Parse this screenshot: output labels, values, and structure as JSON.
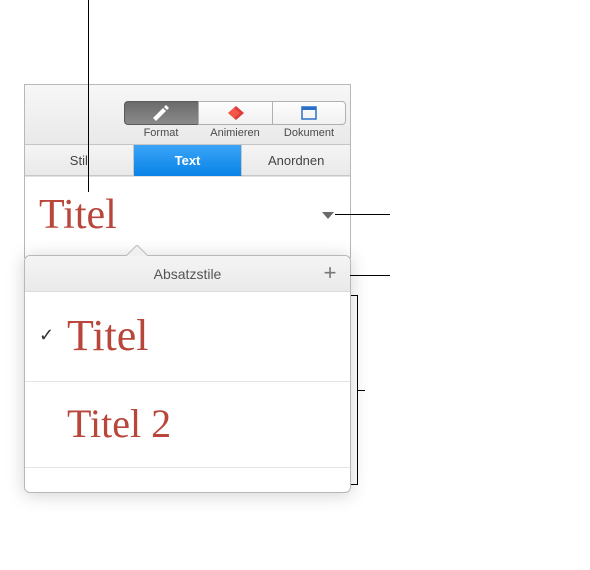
{
  "colors": {
    "accent_text": "#b8463b",
    "selected_tab_top": "#3aa4f8",
    "selected_tab_bottom": "#0a84e6"
  },
  "toolbar": {
    "items": [
      {
        "label": "Format",
        "icon": "brush-icon",
        "active": true
      },
      {
        "label": "Animieren",
        "icon": "diamond-icon",
        "active": false
      },
      {
        "label": "Dokument",
        "icon": "page-icon",
        "active": false
      }
    ]
  },
  "tabs": [
    {
      "label": "Stil",
      "selected": false
    },
    {
      "label": "Text",
      "selected": true
    },
    {
      "label": "Anordnen",
      "selected": false
    }
  ],
  "current_style": "Titel",
  "popover": {
    "title": "Absatzstile",
    "add_icon": "plus-icon",
    "items": [
      {
        "preview": "Titel",
        "selected": true,
        "size_class": "style-title1"
      },
      {
        "preview": "Titel 2",
        "selected": false,
        "size_class": "style-title2"
      }
    ]
  },
  "glyphs": {
    "checkmark": "✓",
    "plus": "+"
  }
}
